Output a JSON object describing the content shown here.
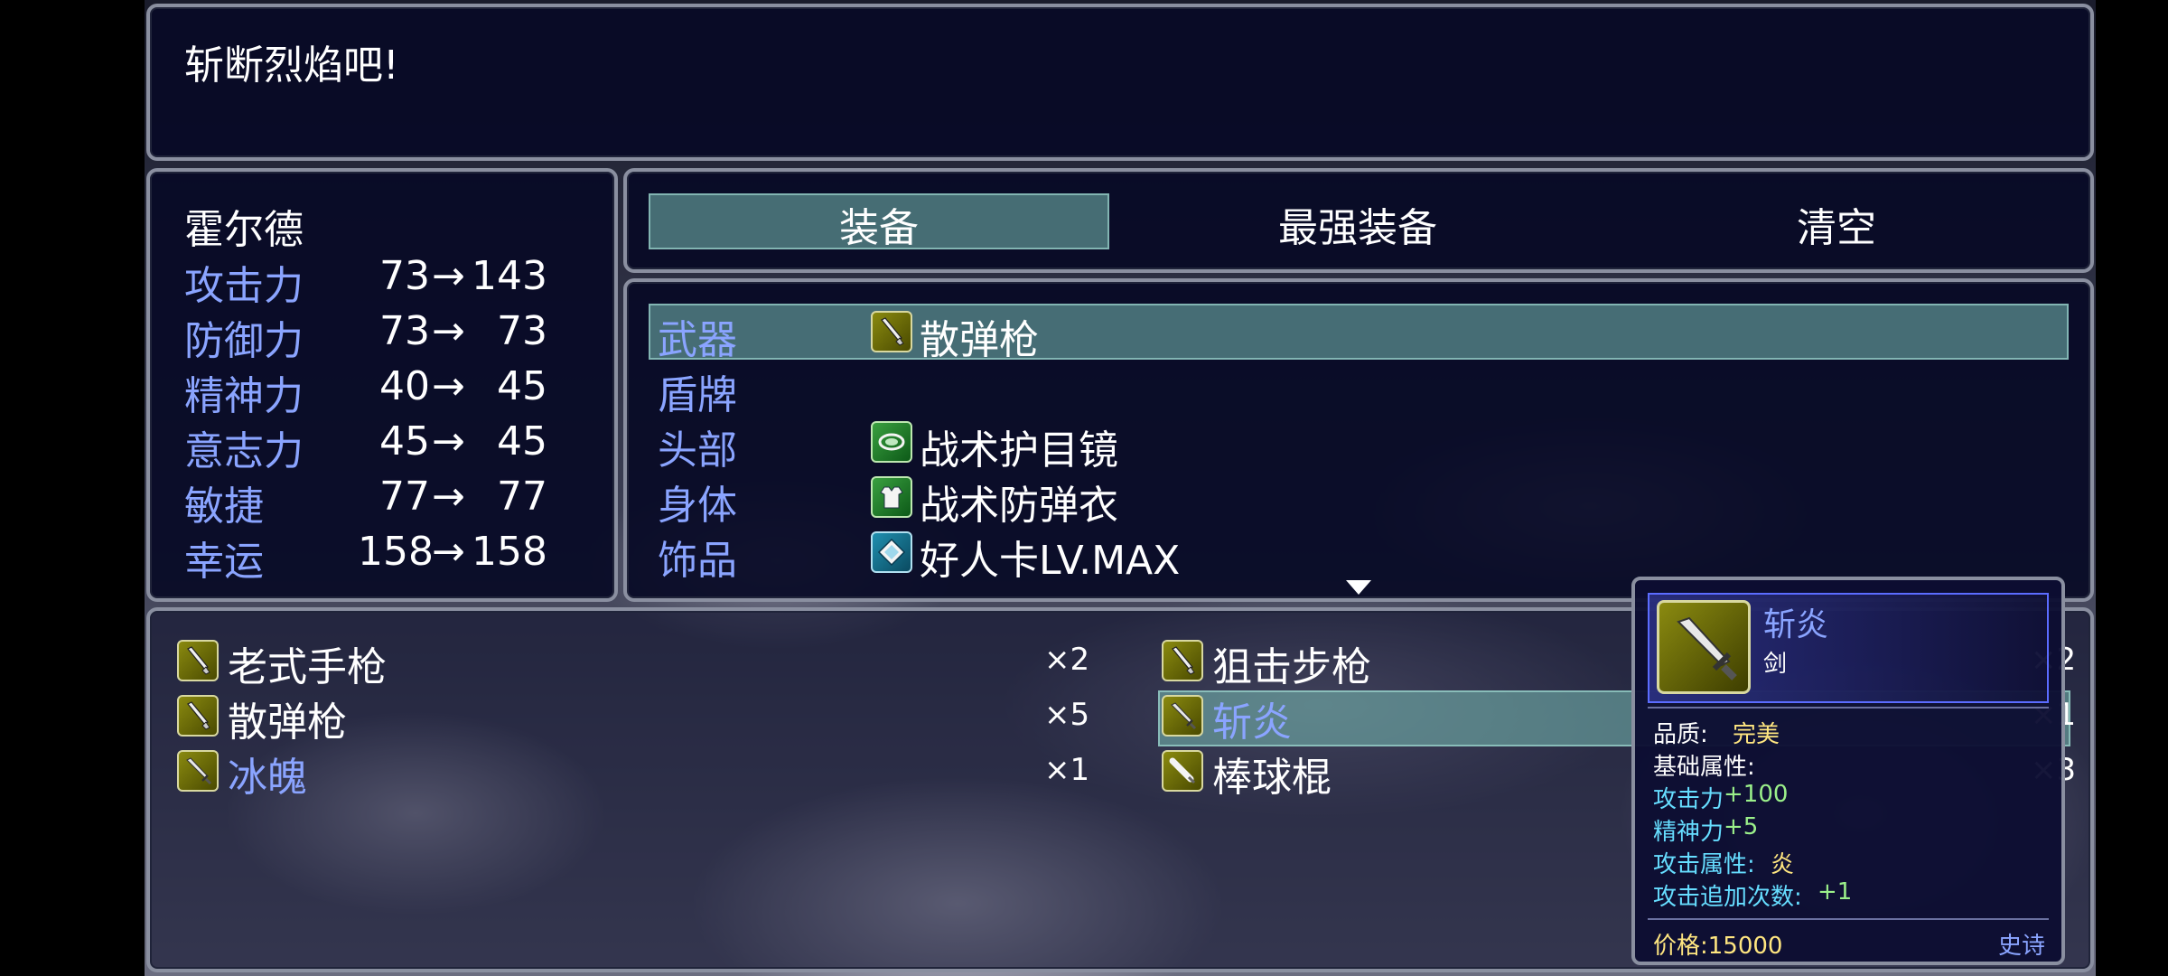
{
  "message": "斩断烈焰吧!",
  "actor": {
    "name": "霍尔德",
    "stats": [
      {
        "label": "攻击力",
        "before": "73",
        "after": "143",
        "up": true
      },
      {
        "label": "防御力",
        "before": "73",
        "after": "73",
        "up": false
      },
      {
        "label": "精神力",
        "before": "40",
        "after": "45",
        "up": true
      },
      {
        "label": "意志力",
        "before": "45",
        "after": "45",
        "up": false
      },
      {
        "label": "敏捷",
        "before": "77",
        "after": "77",
        "up": false
      },
      {
        "label": "幸运",
        "before": "158",
        "after": "158",
        "up": false
      }
    ],
    "arrow": "→"
  },
  "commands": [
    "装备",
    "最强装备",
    "清空"
  ],
  "slots": [
    {
      "slot": "武器",
      "item": "散弹枪",
      "icon": "gun-icon"
    },
    {
      "slot": "盾牌",
      "item": "",
      "icon": ""
    },
    {
      "slot": "头部",
      "item": "战术护目镜",
      "icon": "goggles-icon"
    },
    {
      "slot": "身体",
      "item": "战术防弹衣",
      "icon": "vest-icon"
    },
    {
      "slot": "饰品",
      "item": "好人卡LV.MAX",
      "icon": "card-icon"
    }
  ],
  "inventory": [
    {
      "name": "老式手枪",
      "count": "×2",
      "highlight": false
    },
    {
      "name": "狙击步枪",
      "count": "×2",
      "highlight": false
    },
    {
      "name": "散弹枪",
      "count": "×5",
      "highlight": false
    },
    {
      "name": "斩炎",
      "count": "×1",
      "highlight": true
    },
    {
      "name": "冰魄",
      "count": "×1",
      "highlight": true
    },
    {
      "name": "棒球棍",
      "count": "×3",
      "highlight": false
    }
  ],
  "tooltip": {
    "name": "斩炎",
    "type": "剑",
    "quality_label": "品质:",
    "quality_value": "完美",
    "base_label": "基础属性:",
    "attrs": [
      {
        "label": "攻击力",
        "value": "+100"
      },
      {
        "label": "精神力",
        "value": "+5"
      }
    ],
    "element_label": "攻击属性:",
    "element_value": "炎",
    "extra_label": "攻击追加次数:",
    "extra_value": "+1",
    "price": "价格:15000",
    "rarity": "史诗"
  },
  "colors": {
    "window_bg": "#080a26",
    "border": "#8a8fa0",
    "stat_label": "#8aa4ff",
    "stat_up": "#8cf07c",
    "selection": "#78beb4"
  }
}
